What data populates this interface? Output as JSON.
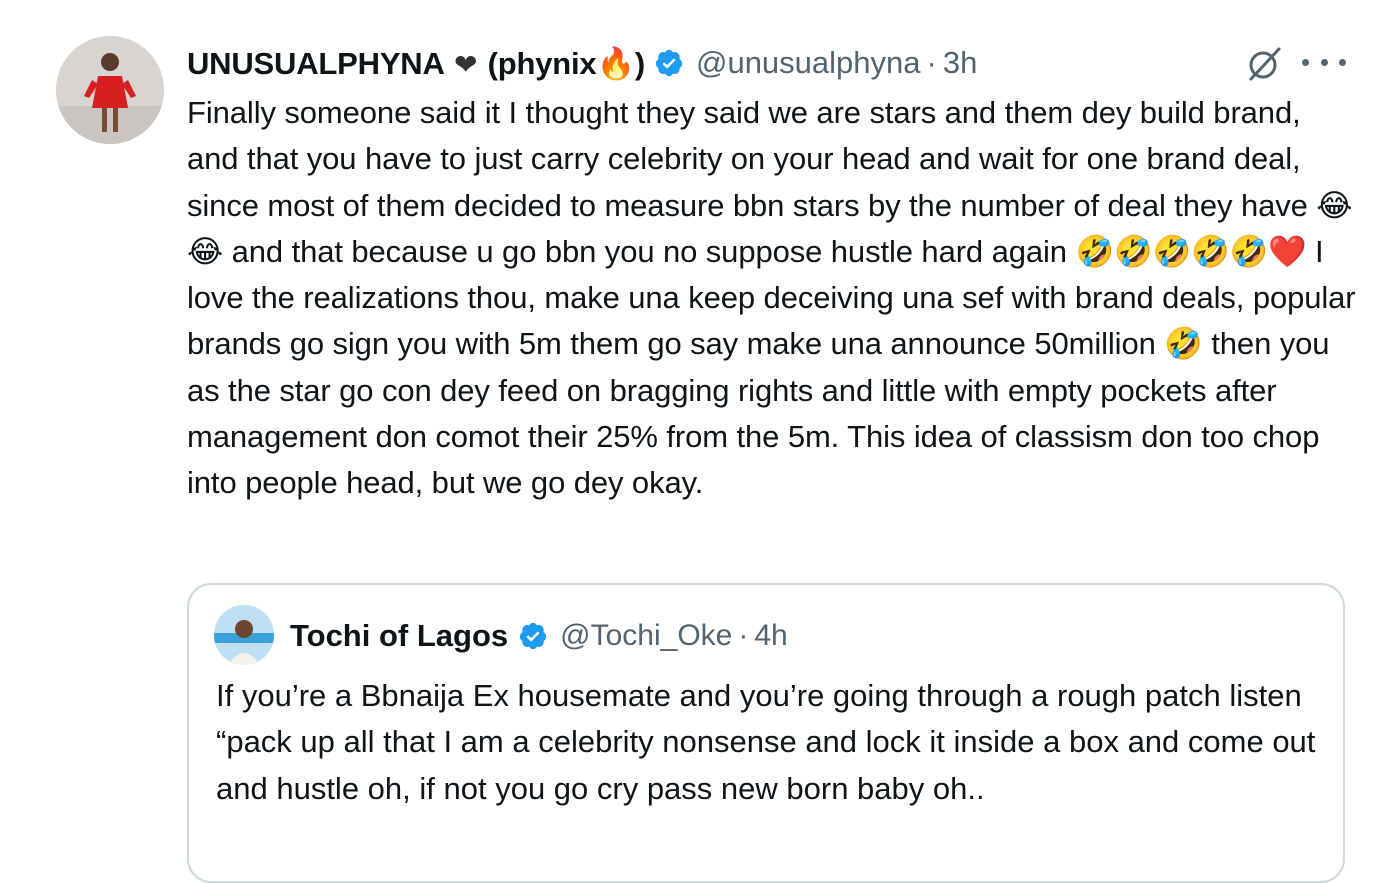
{
  "tweet": {
    "author": {
      "name": "UNUSUALPHYNA",
      "name_emoji": "❤",
      "name_suffix": "(phynix",
      "suffix_emoji": "🔥",
      "suffix_close": ")",
      "handle": "@unusualphyna",
      "separator": "·",
      "time": "3h"
    },
    "text": "Finally someone said it I thought they said we are stars and them dey build brand, and that you have to just carry celebrity on your head and wait for one brand deal, since most of them decided to measure bbn stars by the number of deal they have 😂😂 and that because u go bbn you no suppose hustle hard again 🤣🤣🤣🤣🤣❤️ I love the realizations thou, make una keep deceiving una sef with brand deals, popular brands go sign you with 5m them go say make una announce 50million 🤣 then you as the star go con dey feed on bragging rights and little with empty pockets after management don comot their 25% from the 5m. This idea of classism don too chop into people head, but we go dey okay."
  },
  "quote": {
    "author": {
      "name": "Tochi of Lagos",
      "handle": "@Tochi_Oke",
      "separator": "·",
      "time": "4h"
    },
    "text": "If you’re a Bbnaija Ex housemate and you’re going through a rough patch listen “pack up all that I am a celebrity nonsense and lock it inside a box and come out and hustle oh, if not you go cry pass new born baby oh.."
  },
  "icons": {
    "verified": "verified-badge-icon",
    "grok": "grok-icon",
    "more": "more-icon"
  },
  "colors": {
    "text": "#0f1419",
    "secondary": "#536471",
    "verified": "#1d9bf0",
    "border": "#cfd9de"
  }
}
